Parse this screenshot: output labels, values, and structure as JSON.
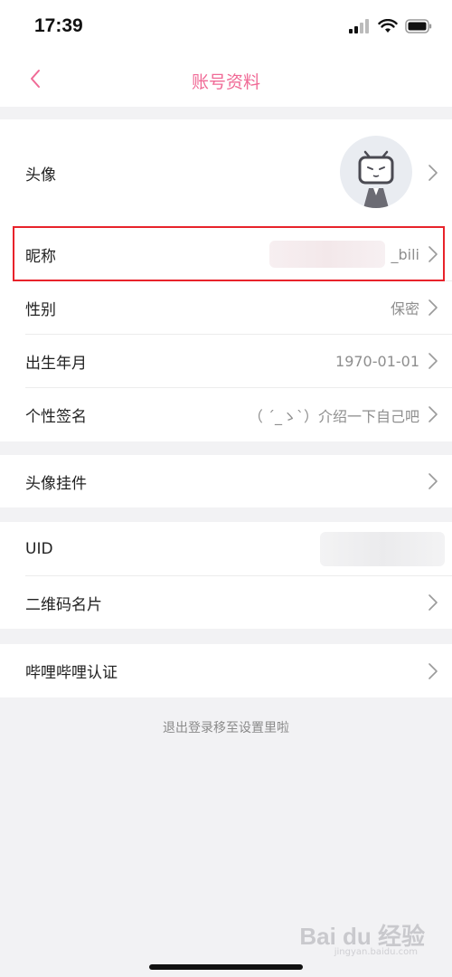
{
  "status_bar": {
    "time": "17:39"
  },
  "nav": {
    "title": "账号资料",
    "back_icon": "chevron-left-icon"
  },
  "profile": {
    "avatar": {
      "label": "头像"
    },
    "nickname": {
      "label": "昵称",
      "value": "_bili"
    },
    "gender": {
      "label": "性别",
      "value": "保密"
    },
    "birthday": {
      "label": "出生年月",
      "value": "1970-01-01"
    },
    "signature": {
      "label": "个性签名",
      "value": "（ ´_ゝ`）介绍一下自己吧"
    }
  },
  "pendant": {
    "label": "头像挂件"
  },
  "account": {
    "uid": {
      "label": "UID"
    },
    "qrcode": {
      "label": "二维码名片"
    }
  },
  "verify": {
    "label": "哔哩哔哩认证"
  },
  "logout_hint": "退出登录移至设置里啦",
  "watermark": {
    "text": "Bai du 经验",
    "sub": "jingyan.baidu.com"
  },
  "colors": {
    "accent": "#f06a96",
    "highlight": "#e8232b",
    "background": "#f2f2f4"
  }
}
